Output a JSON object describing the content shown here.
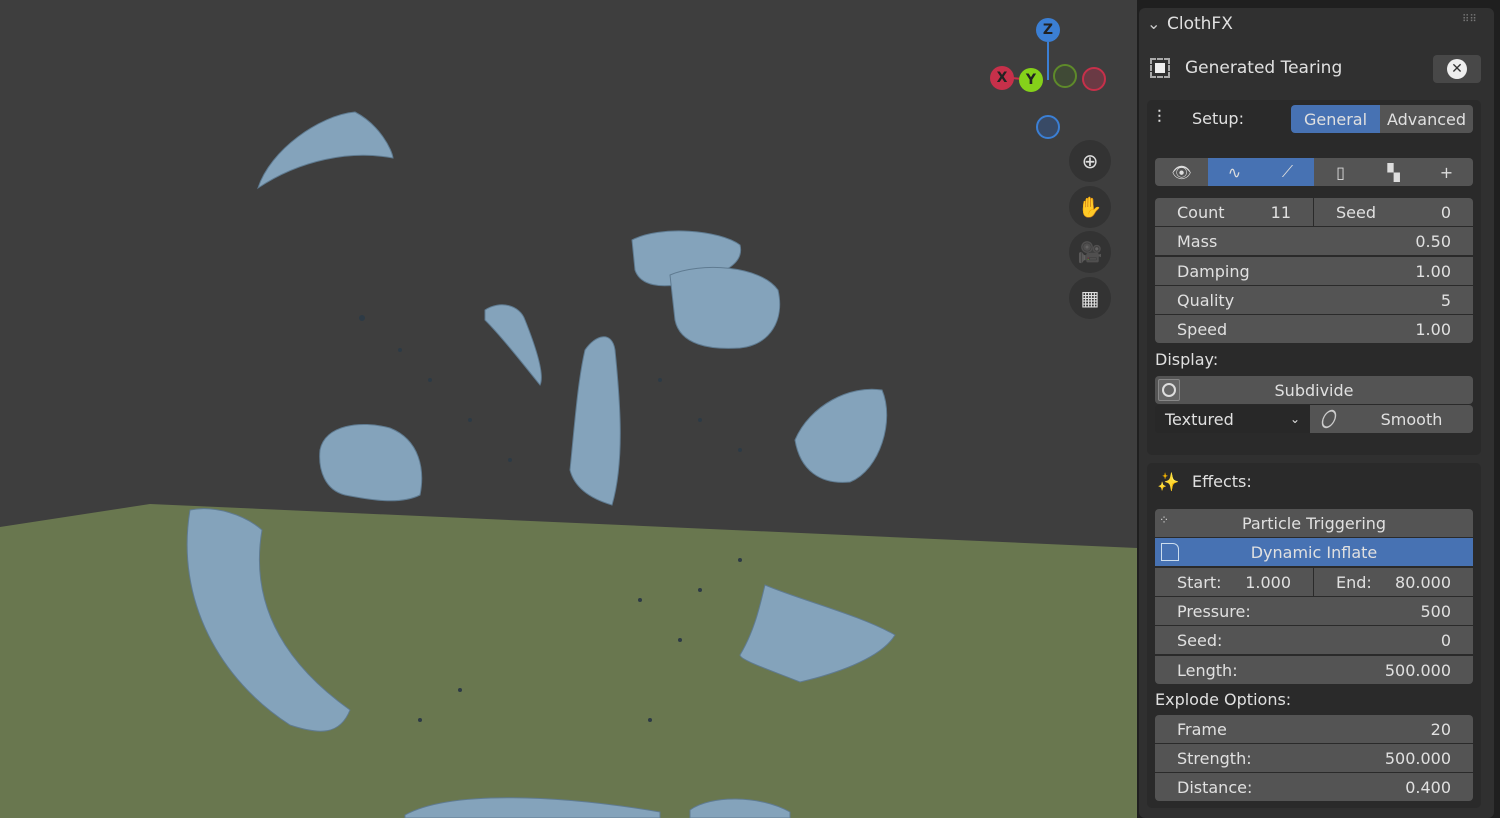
{
  "viewport": {
    "gizmo": {
      "z": "Z",
      "x": "X",
      "y": "Y"
    },
    "nav_icons": [
      "zoom-in-icon",
      "hand-pan-icon",
      "camera-icon",
      "grid-ortho-icon"
    ]
  },
  "panel": {
    "title": "ClothFX",
    "modifier_name": "Generated Tearing",
    "setup_label": "Setup:",
    "setup_tabs": [
      {
        "label": "General",
        "active": true
      },
      {
        "label": "Advanced",
        "active": false
      }
    ],
    "tools": [
      {
        "icon": "eye-icon",
        "active": false
      },
      {
        "icon": "wave-icon",
        "active": true
      },
      {
        "icon": "curve-icon",
        "active": true
      },
      {
        "icon": "frame-icon",
        "active": false
      },
      {
        "icon": "shape-icon",
        "active": false
      },
      {
        "icon": "plus-icon",
        "active": false
      }
    ],
    "count": {
      "label": "Count",
      "value": "11"
    },
    "seed": {
      "label": "Seed",
      "value": "0"
    },
    "fields": [
      {
        "label": "Mass",
        "value": "0.50"
      },
      {
        "label": "Damping",
        "value": "1.00"
      },
      {
        "label": "Quality",
        "value": "5"
      },
      {
        "label": "Speed",
        "value": "1.00"
      }
    ],
    "display_label": "Display:",
    "subdivide": "Subdivide",
    "shading_select": "Textured",
    "smooth": "Smooth",
    "effects_label": "Effects:",
    "particle_triggering": "Particle Triggering",
    "dynamic_inflate": "Dynamic Inflate",
    "start": {
      "label": "Start:",
      "value": "1.000"
    },
    "end": {
      "label": "End:",
      "value": "80.000"
    },
    "effect_fields": [
      {
        "label": "Pressure:",
        "value": "500"
      },
      {
        "label": "Seed:",
        "value": "0"
      },
      {
        "label": "Length:",
        "value": "500.000"
      }
    ],
    "explode_label": "Explode Options:",
    "explode_fields": [
      {
        "label": "Frame",
        "value": "20"
      },
      {
        "label": "Strength:",
        "value": "500.000"
      },
      {
        "label": "Distance:",
        "value": "0.400"
      }
    ],
    "accent": "#4772b3"
  }
}
